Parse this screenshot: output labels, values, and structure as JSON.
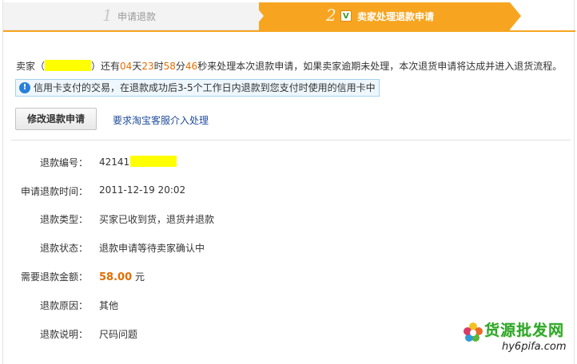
{
  "steps": [
    {
      "num": "1",
      "label": "申请退款"
    },
    {
      "num": "2",
      "label": "卖家处理退款申请"
    }
  ],
  "notice": {
    "prefix": "卖家（",
    "suffix_open": "）还有",
    "days": "04",
    "days_unit": "天",
    "hours": "23",
    "hours_unit": "时",
    "minutes": "58",
    "minutes_unit": "分",
    "seconds": "46",
    "tail": "秒来处理本次退款申请，如果卖家逾期未处理，本次退货申请将达成并进入退货流程。"
  },
  "info": {
    "text": "信用卡支付的交易，在退款成功后3-5个工作日内退款到您支付时使用的信用卡中"
  },
  "actions": {
    "modify_label": "修改退款申请",
    "service_link": "要求淘宝客服介入处理"
  },
  "details": [
    {
      "label": "退款编号：",
      "value": "42141"
    },
    {
      "label": "申请退款时间：",
      "value": "2011-12-19 20:02"
    },
    {
      "label": "退款类型：",
      "value": "买家已收到货，退货并退款"
    },
    {
      "label": "退款状态：",
      "value": "退款申请等待卖家确认中"
    },
    {
      "label": "需要退款金额：",
      "amount": "58.00",
      "unit": " 元"
    },
    {
      "label": "退款原因：",
      "value": "其他"
    },
    {
      "label": "退款说明：",
      "value": "尺码问题"
    }
  ],
  "watermark": {
    "brand": "货源批发网",
    "url": "hy6pifa.com"
  },
  "colors": {
    "accent": "#f7a520",
    "highlight": "#ffff00",
    "number": "#e46e00",
    "link": "#1f4c9c"
  }
}
